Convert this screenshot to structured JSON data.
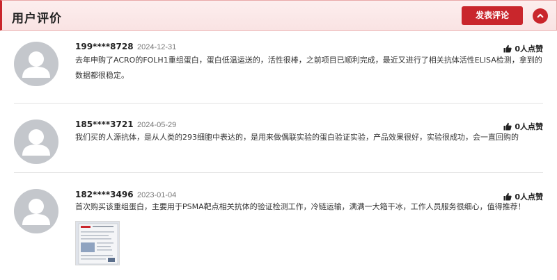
{
  "header": {
    "title": "用户评价",
    "post_button": "发表评论",
    "collapse_icon": "chevron-up-icon"
  },
  "reviews": [
    {
      "user": "199****8728",
      "date": "2024-12-31",
      "likes": "0人点赞",
      "text": "去年申购了ACRO的FOLH1重组蛋白，蛋白低温运送的，活性很棒，之前项目已顺利完成，最近又进行了相关抗体活性ELISA检测，拿到的数据都很稳定。",
      "has_photo": false
    },
    {
      "user": "185****3721",
      "date": "2024-05-29",
      "likes": "0人点赞",
      "text": "我们买的人源抗体，是从人类的293细胞中表达的，是用来做偶联实验的蛋白验证实验，产品效果很好，实验很成功，会一直回购的",
      "has_photo": false
    },
    {
      "user": "182****3496",
      "date": "2023-01-04",
      "likes": "0人点赞",
      "text": "首次购买该重组蛋白，主要用于PSMA靶点相关抗体的验证检测工作，冷链运输，满满一大箱干冰，工作人员服务很细心，值得推荐！",
      "has_photo": true
    }
  ],
  "colors": {
    "accent": "#c9262c",
    "header_bg": "#fdeeee",
    "avatar": "#c4c7cc"
  }
}
